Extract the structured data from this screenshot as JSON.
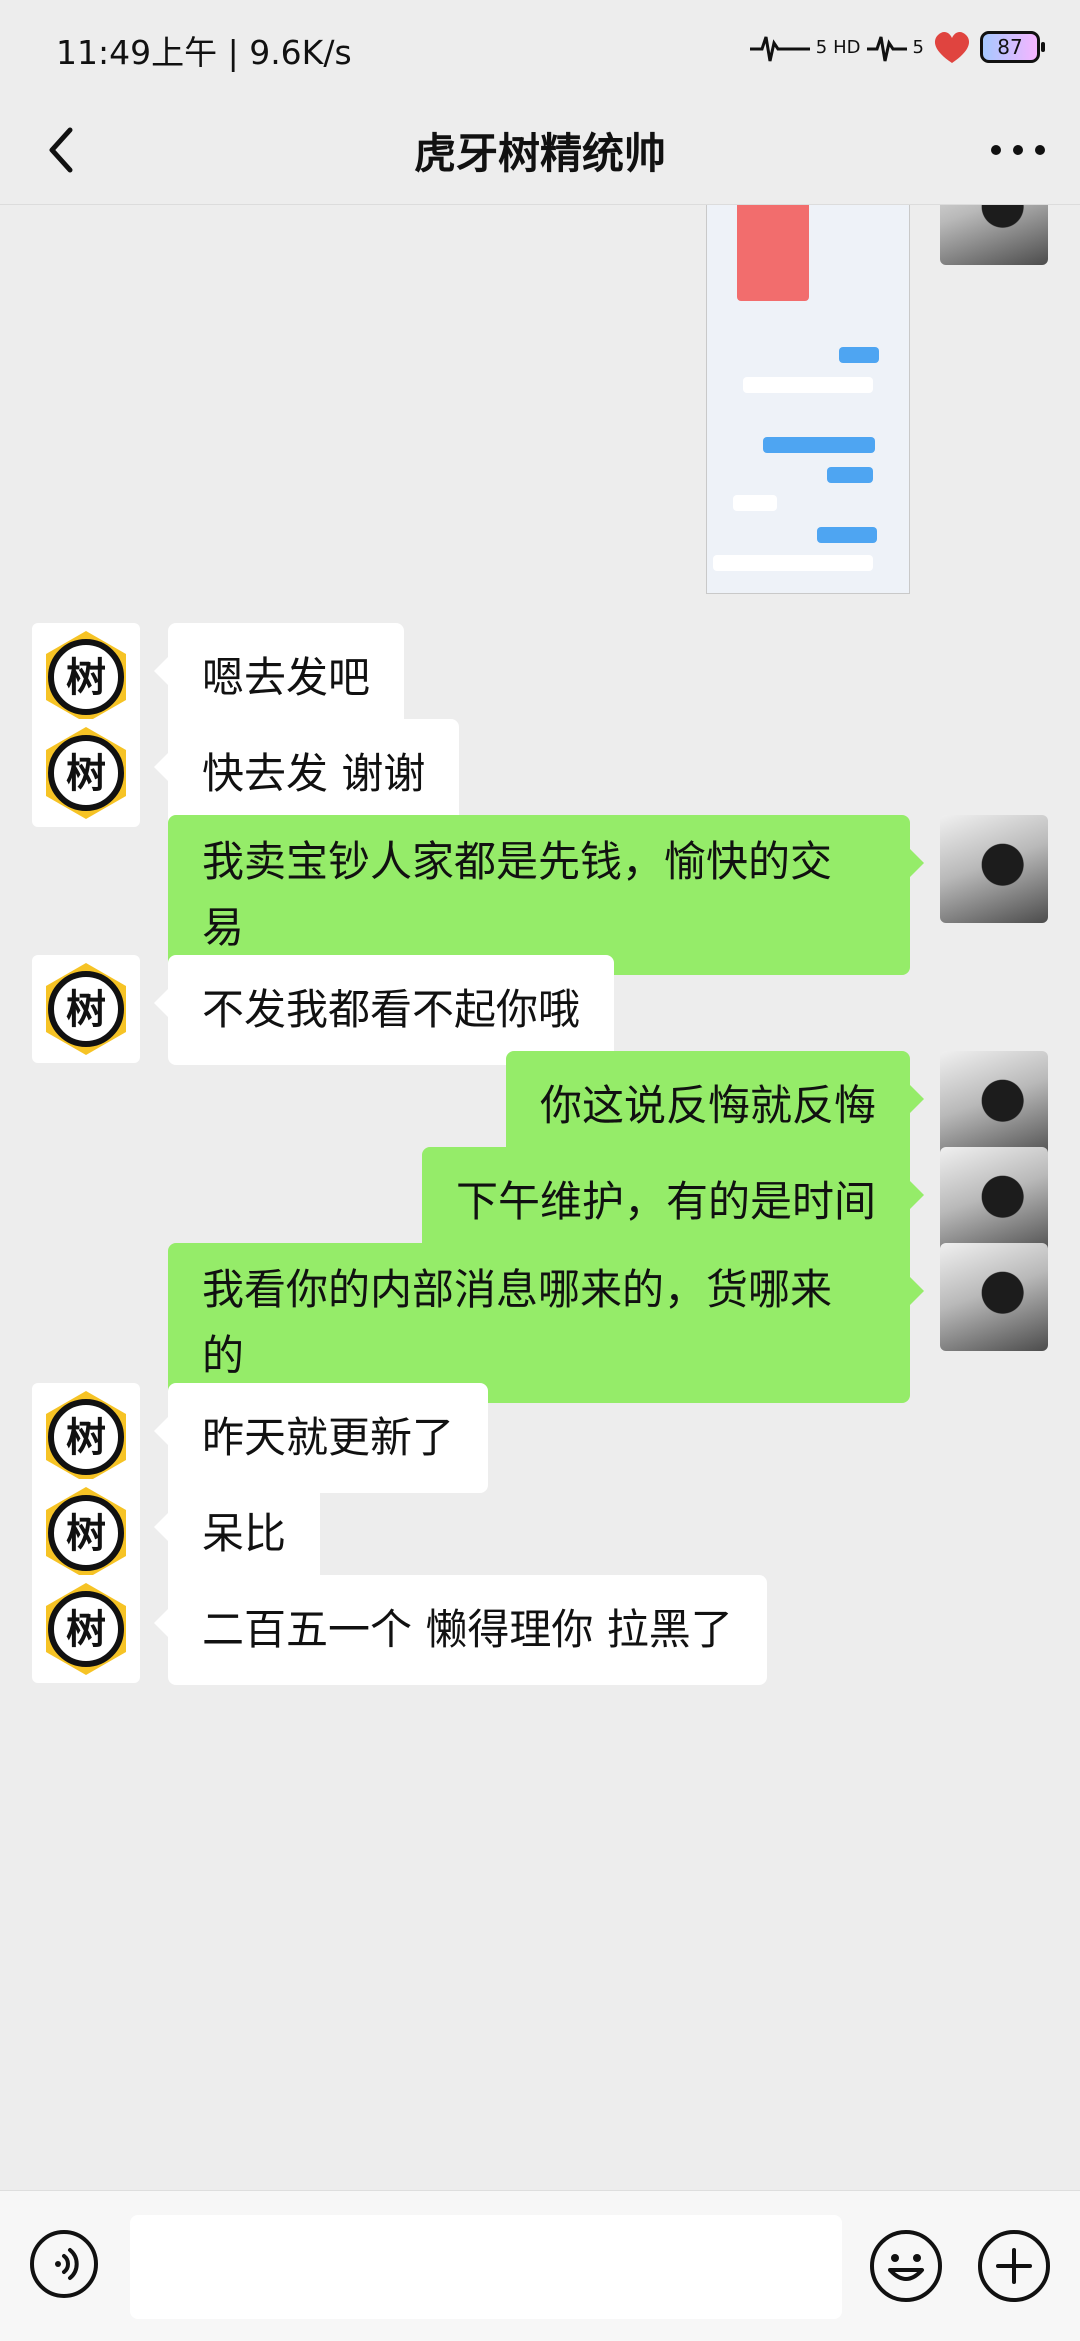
{
  "status_bar": {
    "time": "11:49上午 | 9.6K/s",
    "signal1": "5",
    "hd": "HD",
    "signal2": "5",
    "battery": "87"
  },
  "header": {
    "title": "虎牙树精统帅"
  },
  "contact_avatar_text": "树",
  "messages": [
    {
      "side": "left",
      "text": "嗯去发吧"
    },
    {
      "side": "left",
      "text": "快去发 谢谢"
    },
    {
      "side": "right",
      "line1": "我卖宝钞人家都是先钱，愉快的交",
      "line2": "易"
    },
    {
      "side": "left",
      "text": "不发我都看不起你哦"
    },
    {
      "side": "right",
      "text": "你这说反悔就反悔"
    },
    {
      "side": "right",
      "text": "下午维护，有的是时间"
    },
    {
      "side": "right",
      "line1": "我看你的内部消息哪来的，货哪来",
      "line2": "的"
    },
    {
      "side": "left",
      "text": "昨天就更新了"
    },
    {
      "side": "left",
      "text": "呆比"
    },
    {
      "side": "left",
      "text": "二百五一个 懒得理你 拉黑了"
    }
  ],
  "icons": {
    "back": "chevron-left-icon",
    "more": "more-dots-icon",
    "voice": "voice-icon",
    "emoji": "emoji-icon",
    "plus": "plus-icon"
  }
}
